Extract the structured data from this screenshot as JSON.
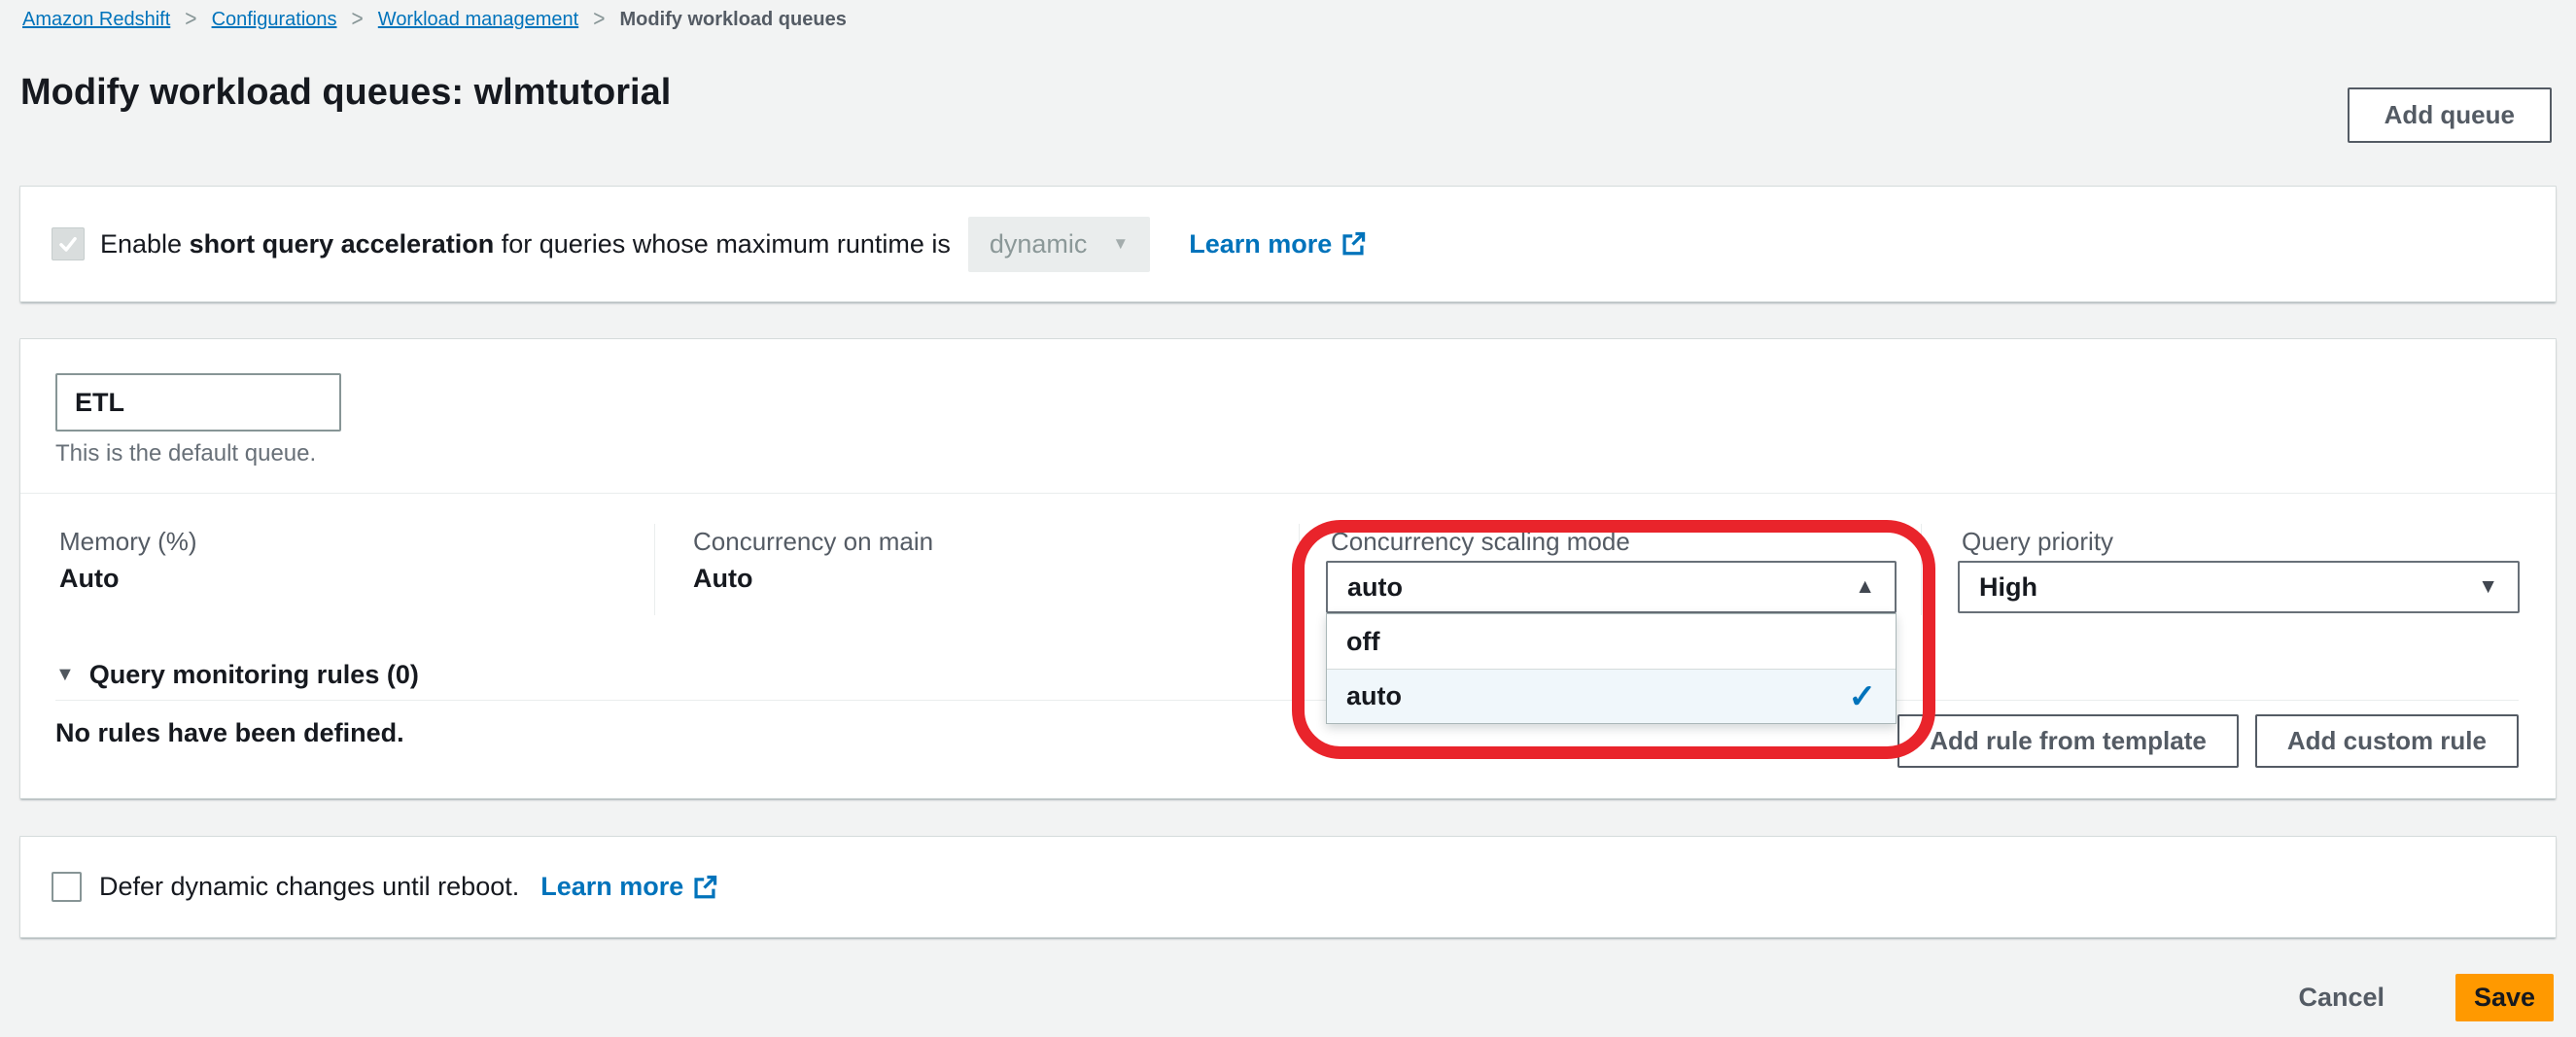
{
  "breadcrumb": {
    "separator": ">",
    "items": [
      {
        "label": "Amazon Redshift"
      },
      {
        "label": "Configurations"
      },
      {
        "label": "Workload management"
      },
      {
        "label": "Modify workload queues"
      }
    ]
  },
  "header": {
    "title": "Modify workload queues: wlmtutorial",
    "add_queue_label": "Add queue"
  },
  "sqa": {
    "checkbox_state": "checked-disabled",
    "text_prefix": "Enable ",
    "text_bold": "short query acceleration",
    "text_suffix": " for queries whose maximum runtime is",
    "runtime_select_value": "dynamic",
    "learn_more_label": "Learn more"
  },
  "queue": {
    "name_value": "ETL",
    "helper_text": "This is the default queue.",
    "fields": [
      {
        "label": "Memory (%)",
        "value": "Auto"
      },
      {
        "label": "Concurrency on main",
        "value": "Auto"
      }
    ],
    "concurrency_scaling": {
      "label": "Concurrency scaling mode",
      "value": "auto",
      "options": [
        {
          "label": "off",
          "selected": false
        },
        {
          "label": "auto",
          "selected": true
        }
      ],
      "check_icon": "✓"
    },
    "query_priority": {
      "label": "Query priority",
      "value": "High"
    },
    "qmr": {
      "header": "Query monitoring rules (0)",
      "empty_text": "No rules have been defined.",
      "add_rule_template_label": "Add rule from template",
      "add_custom_rule_label": "Add custom rule"
    }
  },
  "defer": {
    "checkbox_state": "unchecked",
    "text": "Defer dynamic changes until reboot.",
    "learn_more_label": "Learn more"
  },
  "footer": {
    "cancel_label": "Cancel",
    "save_label": "Save"
  },
  "glyphs": {
    "caret_down": "▼",
    "caret_up": "▲",
    "section_triangle": "▼"
  },
  "colors": {
    "link_blue": "#0073bb",
    "save_orange": "#ff9900",
    "annotation_red": "#e9242b",
    "selected_option_bg": "#f0f7fb",
    "check_blue": "#0073bb",
    "button_gray": "#545b64",
    "page_bg": "#f2f3f3"
  }
}
